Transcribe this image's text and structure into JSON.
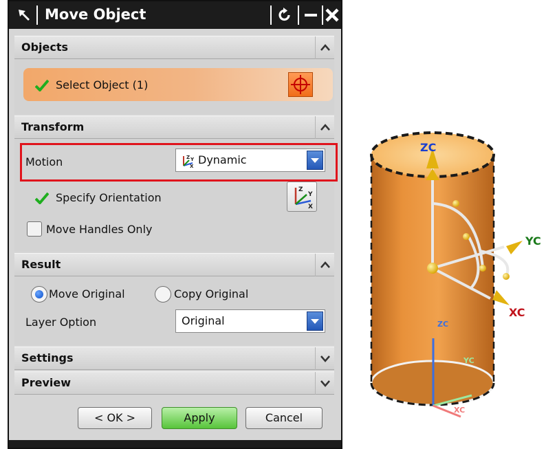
{
  "dialog": {
    "title": "Move Object"
  },
  "sections": {
    "objects": {
      "header": "Objects",
      "select_object_label": "Select Object (1)"
    },
    "transform": {
      "header": "Transform",
      "motion_label": "Motion",
      "motion_value": "Dynamic",
      "specify_orientation_label": "Specify Orientation",
      "move_handles_only_label": "Move Handles Only",
      "move_handles_only_checked": false
    },
    "result": {
      "header": "Result",
      "move_original_label": "Move Original",
      "copy_original_label": "Copy Original",
      "selected_option": "Move Original",
      "layer_option_label": "Layer Option",
      "layer_option_value": "Original"
    },
    "settings": {
      "header": "Settings"
    },
    "preview": {
      "header": "Preview"
    }
  },
  "buttons": {
    "ok": "< OK >",
    "apply": "Apply",
    "cancel": "Cancel"
  },
  "viewport": {
    "axis_labels": {
      "zc_top": "ZC",
      "yc_handle": "YC",
      "xc_handle": "XC",
      "zc_triad": "ZC",
      "yc_triad": "YC",
      "xc_triad": "XC"
    },
    "cylinder_color": "#e8913a",
    "handle_color": "#f0c020"
  },
  "colors": {
    "highlight": "#e0141c",
    "select_row": "#f2a86a",
    "dropdown_arrow": "#2458b8",
    "apply_button": "#57c43a"
  }
}
